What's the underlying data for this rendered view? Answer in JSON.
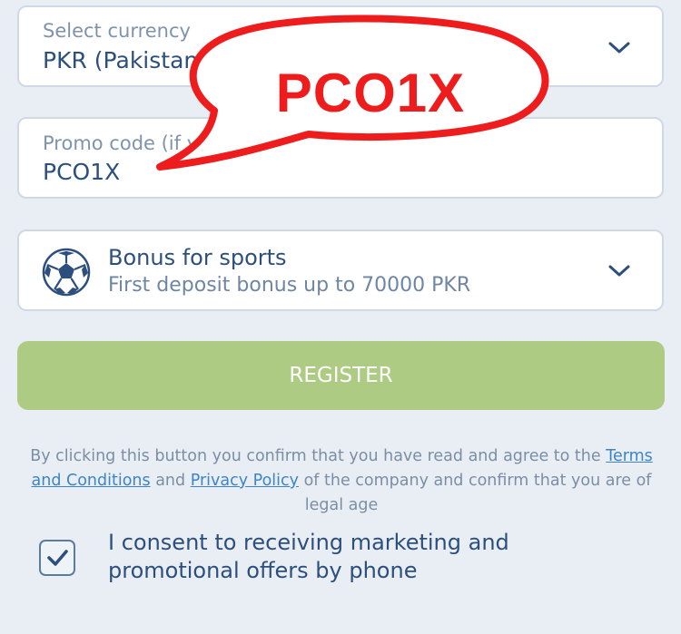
{
  "currency": {
    "label": "Select currency",
    "value": "PKR (Pakistani r"
  },
  "promo": {
    "label": "Promo code (if y",
    "value": "PCO1X"
  },
  "bonus": {
    "title": "Bonus for sports",
    "subtitle": "First deposit bonus up to 70000 PKR"
  },
  "register": {
    "label": "REGISTER"
  },
  "legal": {
    "prefix": "By clicking this button you confirm that you have read and agree to the",
    "terms_link": "Terms and Conditions",
    "and": "and",
    "privacy_link": "Privacy Policy",
    "suffix": "of the company and confirm that you are of legal age"
  },
  "consent": {
    "checked": true,
    "text": "I consent to receiving marketing and promotional offers by phone"
  },
  "callout": {
    "text": "PCO1X",
    "color": "#ee1c1c"
  },
  "colors": {
    "background": "#e9eef4",
    "accent_text": "#2c4f7d",
    "register_bg": "#adcb82",
    "link": "#3d85c6"
  }
}
